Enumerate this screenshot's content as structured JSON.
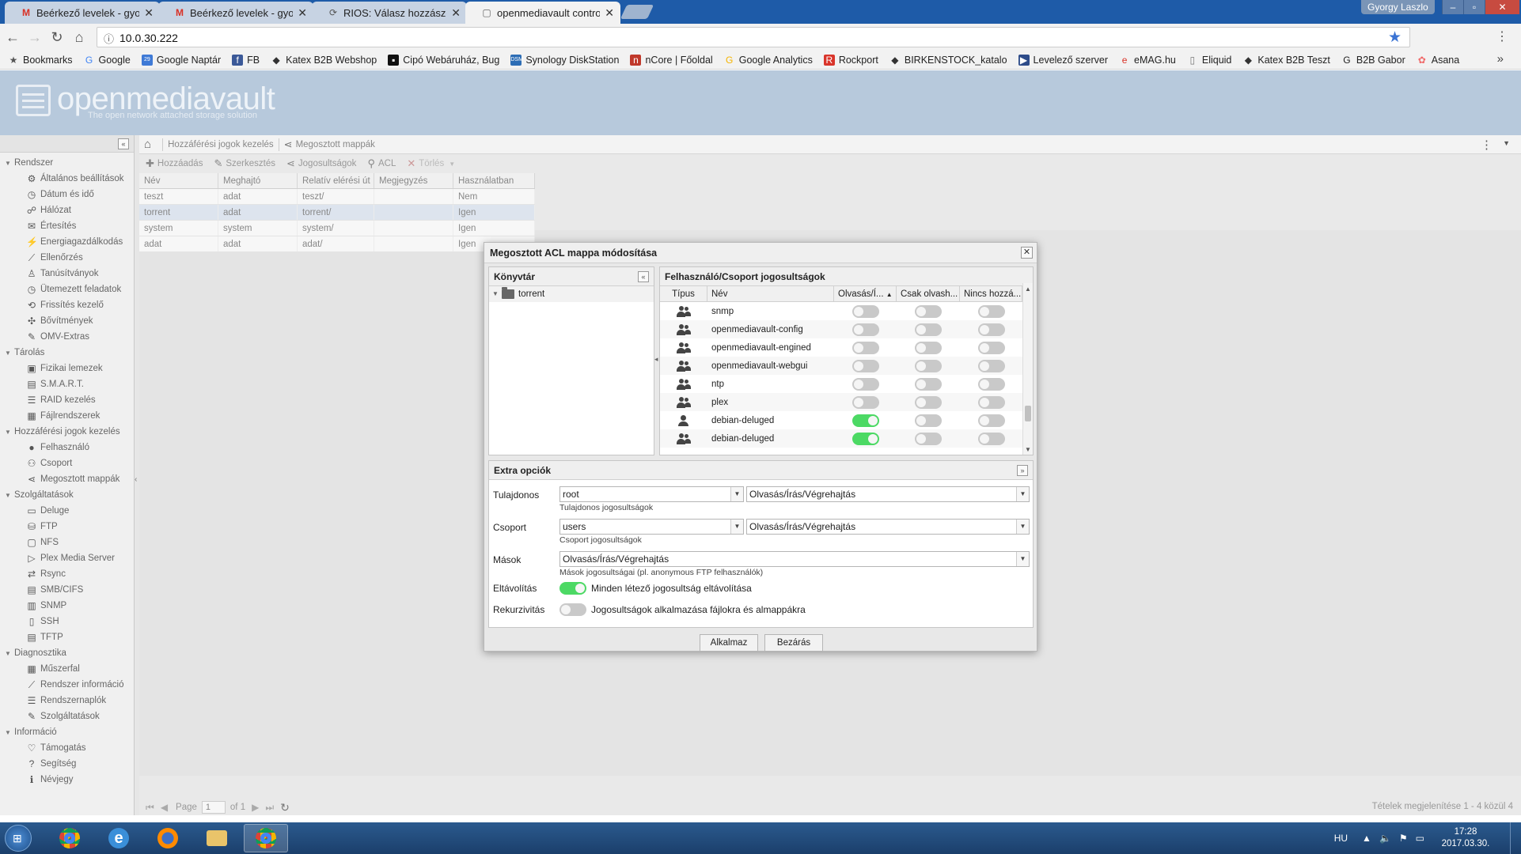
{
  "browser": {
    "tabs": [
      {
        "title": "Beérkező levelek - gyorg",
        "icon": "gmail-icon"
      },
      {
        "title": "Beérkező levelek - gyorg",
        "icon": "gmail-icon"
      },
      {
        "title": "RIOS: Válasz hozzászólás",
        "icon": "web-icon"
      },
      {
        "title": "openmediavault control",
        "icon": "page-icon"
      }
    ],
    "user": "Gyorgy Laszlo",
    "url": "10.0.30.222",
    "bookmarks": [
      "Bookmarks",
      "Google",
      "Google Naptár",
      "FB",
      "Katex B2B Webshop",
      "Cipó Webáruház, Bug",
      "Synology DiskStation",
      "nCore | Főoldal",
      "Google Analytics",
      "Rockport",
      "BIRKENSTOCK_katalo",
      "Levelező szerver",
      "eMAG.hu",
      "Eliquid",
      "Katex B2B Teszt",
      "B2B Gabor",
      "Asana"
    ]
  },
  "omv": {
    "title": "openmediavault",
    "subtitle": "The open network attached storage solution"
  },
  "sidebar": [
    {
      "group": "Rendszer",
      "items": [
        {
          "label": "Általános beállítások",
          "icon": "gear-icon"
        },
        {
          "label": "Dátum és idő",
          "icon": "clock-icon"
        },
        {
          "label": "Hálózat",
          "icon": "network-icon"
        },
        {
          "label": "Értesítés",
          "icon": "mail-icon"
        },
        {
          "label": "Energiagazdálkodás",
          "icon": "power-icon"
        },
        {
          "label": "Ellenőrzés",
          "icon": "chart-icon"
        },
        {
          "label": "Tanúsítványok",
          "icon": "certificate-icon"
        },
        {
          "label": "Ütemezett feladatok",
          "icon": "clock-icon"
        },
        {
          "label": "Frissítés kezelő",
          "icon": "update-icon"
        },
        {
          "label": "Bővítmények",
          "icon": "puzzle-icon"
        },
        {
          "label": "OMV-Extras",
          "icon": "wrench-icon"
        }
      ]
    },
    {
      "group": "Tárolás",
      "items": [
        {
          "label": "Fizikai lemezek",
          "icon": "disk-icon"
        },
        {
          "label": "S.M.A.R.T.",
          "icon": "smart-icon"
        },
        {
          "label": "RAID kezelés",
          "icon": "raid-icon"
        },
        {
          "label": "Fájlrendszerek",
          "icon": "filesystem-icon"
        }
      ]
    },
    {
      "group": "Hozzáférési jogok kezelés",
      "items": [
        {
          "label": "Felhasználó",
          "icon": "user-icon"
        },
        {
          "label": "Csoport",
          "icon": "group-icon"
        },
        {
          "label": "Megosztott mappák",
          "icon": "share-icon"
        }
      ]
    },
    {
      "group": "Szolgáltatások",
      "items": [
        {
          "label": "Deluge",
          "icon": "monitor-icon"
        },
        {
          "label": "FTP",
          "icon": "ftp-icon"
        },
        {
          "label": "NFS",
          "icon": "nfs-icon"
        },
        {
          "label": "Plex Media Server",
          "icon": "plex-icon"
        },
        {
          "label": "Rsync",
          "icon": "sync-icon"
        },
        {
          "label": "SMB/CIFS",
          "icon": "smb-icon"
        },
        {
          "label": "SNMP",
          "icon": "snmp-icon"
        },
        {
          "label": "SSH",
          "icon": "terminal-icon"
        },
        {
          "label": "TFTP",
          "icon": "tftp-icon"
        }
      ]
    },
    {
      "group": "Diagnosztika",
      "items": [
        {
          "label": "Műszerfal",
          "icon": "dashboard-icon"
        },
        {
          "label": "Rendszer információ",
          "icon": "chart-icon"
        },
        {
          "label": "Rendszernaplók",
          "icon": "log-icon"
        },
        {
          "label": "Szolgáltatások",
          "icon": "wrench-icon"
        }
      ]
    },
    {
      "group": "Információ",
      "items": [
        {
          "label": "Támogatás",
          "icon": "heart-icon"
        },
        {
          "label": "Segítség",
          "icon": "help-icon"
        },
        {
          "label": "Névjegy",
          "icon": "info-icon"
        }
      ]
    }
  ],
  "breadcrumb": {
    "section": "Hozzáférési jogok kezelés",
    "page": "Megosztott mappák"
  },
  "grid_toolbar": {
    "add": "Hozzáadás",
    "edit": "Szerkesztés",
    "privileges": "Jogosultságok",
    "acl": "ACL",
    "delete": "Törlés"
  },
  "grid": {
    "columns": [
      "Név",
      "Meghajtó",
      "Relatív elérési út",
      "Megjegyzés",
      "Használatban"
    ],
    "rows": [
      [
        "teszt",
        "adat",
        "teszt/",
        "",
        "Nem"
      ],
      [
        "torrent",
        "adat",
        "torrent/",
        "",
        "Igen"
      ],
      [
        "system",
        "system",
        "system/",
        "",
        "Igen"
      ],
      [
        "adat",
        "adat",
        "adat/",
        "",
        "Igen"
      ]
    ]
  },
  "pager": {
    "page_label": "Page",
    "page": "1",
    "of_label": "of 1",
    "display": "Tételek megjelenítése 1 - 4 közül 4"
  },
  "modal": {
    "title": "Megosztott ACL mappa módosítása",
    "library_title": "Könyvtár",
    "folder": "torrent",
    "permissions_title": "Felhasználó/Csoport jogosultságok",
    "perm_columns": [
      "Típus",
      "Név",
      "Olvasás/Í...",
      "Csak olvash...",
      "Nincs hozzá..."
    ],
    "perm_rows": [
      {
        "type": "group",
        "name": "snmp",
        "rw": false,
        "ro": false,
        "none": false
      },
      {
        "type": "group",
        "name": "openmediavault-config",
        "rw": false,
        "ro": false,
        "none": false
      },
      {
        "type": "group",
        "name": "openmediavault-engined",
        "rw": false,
        "ro": false,
        "none": false
      },
      {
        "type": "group",
        "name": "openmediavault-webgui",
        "rw": false,
        "ro": false,
        "none": false
      },
      {
        "type": "group",
        "name": "ntp",
        "rw": false,
        "ro": false,
        "none": false
      },
      {
        "type": "group",
        "name": "plex",
        "rw": false,
        "ro": false,
        "none": false
      },
      {
        "type": "user",
        "name": "debian-deluged",
        "rw": true,
        "ro": false,
        "none": false
      },
      {
        "type": "group",
        "name": "debian-deluged",
        "rw": true,
        "ro": false,
        "none": false
      }
    ],
    "extra": {
      "title": "Extra opciók",
      "owner_label": "Tulajdonos",
      "owner_value": "root",
      "owner_perm": "Olvasás/Írás/Végrehajtás",
      "owner_hint": "Tulajdonos jogosultságok",
      "group_label": "Csoport",
      "group_value": "users",
      "group_perm": "Olvasás/Írás/Végrehajtás",
      "group_hint": "Csoport jogosultságok",
      "others_label": "Mások",
      "others_perm": "Olvasás/Írás/Végrehajtás",
      "others_hint": "Mások jogosultságai (pl. anonymous FTP felhasználók)",
      "remove_label": "Eltávolítás",
      "remove_text": "Minden létező jogosultság eltávolítása",
      "remove_on": true,
      "recursive_label": "Rekurzivitás",
      "recursive_text": "Jogosultságok alkalmazása fájlokra és almappákra",
      "recursive_on": false
    },
    "apply_label": "Alkalmaz",
    "close_label": "Bezárás"
  },
  "taskbar": {
    "lang": "HU",
    "time": "17:28",
    "date": "2017.03.30."
  }
}
